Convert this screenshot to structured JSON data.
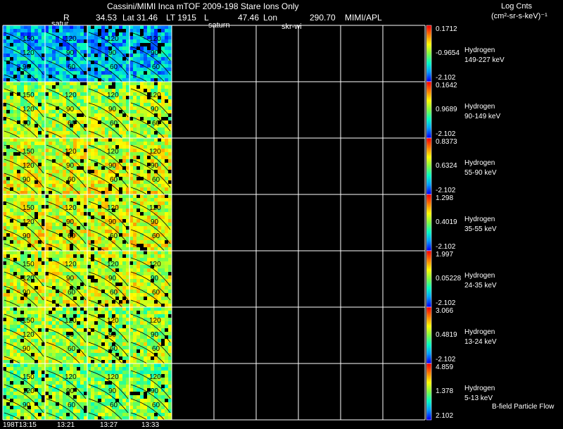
{
  "header": {
    "title": "Cassini/MIMI Inca mTOF  2009-198   Stare   Ions Only",
    "info_R": "R",
    "info_R_val": "34.53",
    "info_lat": "Lat 31.46",
    "info_lt": "LT 1915",
    "info_l": "L",
    "info_lonval": "47.46",
    "info_lon": "Lon",
    "info_lonval2": "290.70",
    "info_inst": "MIMI/APL",
    "units_line1": "Log Cnts",
    "units_line2": "(cm²-sr-s-keV)⁻¹",
    "label_saturn_1": "satur",
    "label_saturn_2": "saturn",
    "label_skr": "skr-wi"
  },
  "footer": {
    "bfield_label": "B-field Particle Flow"
  },
  "chart_data": {
    "type": "heatmap",
    "time_labels": [
      "198T13:15",
      "13:21",
      "13:27",
      "13:33"
    ],
    "contour_labels": [
      "150",
      "120",
      "90",
      "60",
      "30"
    ],
    "colormap": [
      "#0000ff",
      "#00a0ff",
      "#00ffc0",
      "#80ff40",
      "#ffff00",
      "#ff8000",
      "#ff0000"
    ],
    "panels": [
      {
        "species": "Hydrogen",
        "energy": "149-227 keV",
        "max": "0.1712",
        "mid": "-0.9654",
        "min": "-2.102",
        "level": 0.22
      },
      {
        "species": "Hydrogen",
        "energy": "90-149 keV",
        "max": "0.1642",
        "mid": "0.9689",
        "min": "-2.102",
        "level": 0.55
      },
      {
        "species": "Hydrogen",
        "energy": "55-90 keV",
        "max": "0.8373",
        "mid": "0.6324",
        "min": "-2.102",
        "level": 0.62
      },
      {
        "species": "Hydrogen",
        "energy": "35-55 keV",
        "max": "1.298",
        "mid": "0.4019",
        "min": "-2.102",
        "level": 0.62
      },
      {
        "species": "Hydrogen",
        "energy": "24-35 keV",
        "max": "1.997",
        "mid": "0.05228",
        "min": "-2.102",
        "level": 0.6
      },
      {
        "species": "Hydrogen",
        "energy": "13-24 keV",
        "max": "3.066",
        "mid": "0.4819",
        "min": "-2.102",
        "level": 0.55
      },
      {
        "species": "Hydrogen",
        "energy": "5-13 keV",
        "max": "4.859",
        "mid": "1.378",
        "min": "2.102",
        "level": 0.5
      }
    ]
  }
}
